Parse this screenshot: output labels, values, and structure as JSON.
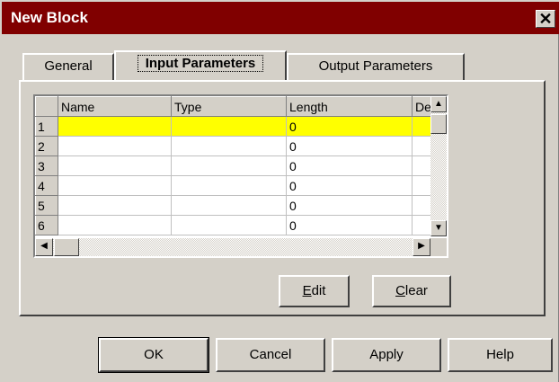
{
  "window": {
    "title": "New Block",
    "close_glyph": "✕"
  },
  "tabs": [
    {
      "label": "General"
    },
    {
      "label": "Input Parameters"
    },
    {
      "label": "Output Parameters"
    }
  ],
  "grid": {
    "columns": [
      "Name",
      "Type",
      "Length",
      "De"
    ],
    "rows": [
      {
        "num": "1",
        "name": "",
        "type": "",
        "length": "0",
        "de": ""
      },
      {
        "num": "2",
        "name": "",
        "type": "",
        "length": "0",
        "de": ""
      },
      {
        "num": "3",
        "name": "",
        "type": "",
        "length": "0",
        "de": ""
      },
      {
        "num": "4",
        "name": "",
        "type": "",
        "length": "0",
        "de": ""
      },
      {
        "num": "5",
        "name": "",
        "type": "",
        "length": "0",
        "de": ""
      },
      {
        "num": "6",
        "name": "",
        "type": "",
        "length": "0",
        "de": ""
      }
    ],
    "selected_row": 1
  },
  "panel_buttons": {
    "edit": {
      "hotkey": "E",
      "rest": "dit"
    },
    "clear": {
      "hotkey": "C",
      "rest": "lear"
    }
  },
  "dialog_buttons": {
    "ok": "OK",
    "cancel": "Cancel",
    "apply": "Apply",
    "help": "Help"
  },
  "colors": {
    "titlebar": "#800000",
    "selection": "#ffff00",
    "face": "#d4d0c8"
  },
  "icons": {
    "scroll_up": "▲",
    "scroll_down": "▼",
    "scroll_left": "◀",
    "scroll_right": "▶"
  }
}
